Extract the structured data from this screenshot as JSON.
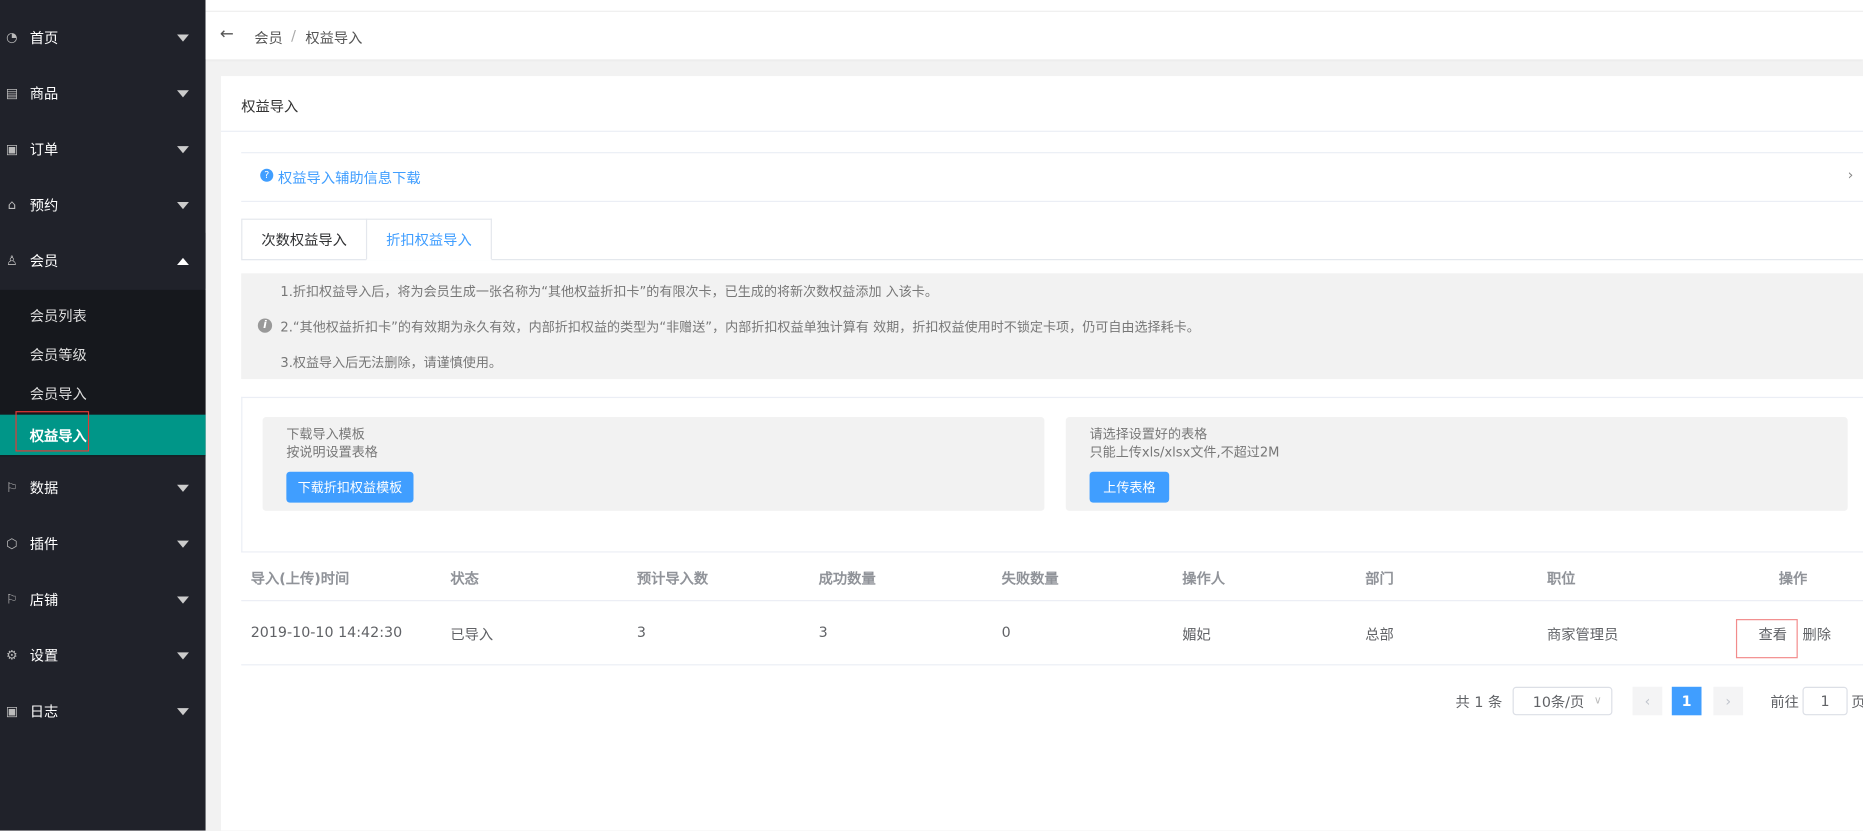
{
  "sidebar": {
    "items": [
      {
        "label": "首页",
        "icon": "dashboard-icon"
      },
      {
        "label": "商品",
        "icon": "document-icon"
      },
      {
        "label": "订单",
        "icon": "clipboard-icon"
      },
      {
        "label": "预约",
        "icon": "home-icon"
      },
      {
        "label": "会员",
        "icon": "user-icon"
      },
      {
        "label": "数据",
        "icon": "flag-icon"
      },
      {
        "label": "插件",
        "icon": "cube-icon"
      },
      {
        "label": "店铺",
        "icon": "flag-icon"
      },
      {
        "label": "设置",
        "icon": "gear-icon"
      },
      {
        "label": "日志",
        "icon": "clipboard-icon"
      }
    ],
    "submenu": [
      "会员列表",
      "会员等级",
      "会员导入",
      "权益导入"
    ]
  },
  "breadcrumb": {
    "parent": "会员",
    "sep": "/",
    "current": "权益导入"
  },
  "card": {
    "title": "权益导入",
    "help_link": "权益导入辅助信息下载"
  },
  "tabs": [
    "次数权益导入",
    "折扣权益导入"
  ],
  "notice": [
    "1.折扣权益导入后，将为会员生成一张名称为“其他权益折扣卡”的有限次卡，已生成的将新次数权益添加 入该卡。",
    "2.“其他权益折扣卡”的有效期为永久有效，内部折扣权益的类型为“非赠送”，内部折扣权益单独计算有 效期，折扣权益使用时不锁定卡项，仍可自由选择耗卡。",
    "3.权益导入后无法删除，请谨慎使用。"
  ],
  "download": {
    "line1": "下载导入模板",
    "line2": "按说明设置表格",
    "button": "下载折扣权益模板"
  },
  "upload": {
    "line1": "请选择设置好的表格",
    "line2": "只能上传xls/xlsx文件,不超过2M",
    "button": "上传表格"
  },
  "table": {
    "headers": [
      "导入(上传)时间",
      "状态",
      "预计导入数",
      "成功数量",
      "失败数量",
      "操作人",
      "部门",
      "职位",
      "操作"
    ],
    "rows": [
      {
        "cells": [
          "2019-10-10 14:42:30",
          "已导入",
          "3",
          "3",
          "0",
          "媚妃",
          "总部",
          "商家管理员"
        ],
        "view": "查看",
        "delete": "删除"
      }
    ]
  },
  "pagination": {
    "total": "共 1 条",
    "page_size": "10条/页",
    "current": "1",
    "goto_label": "前往",
    "goto_value": "1",
    "page_suffix": "页"
  },
  "colors": {
    "accent": "#409eff",
    "active_menu": "#009688",
    "sidebar": "#20222a"
  }
}
